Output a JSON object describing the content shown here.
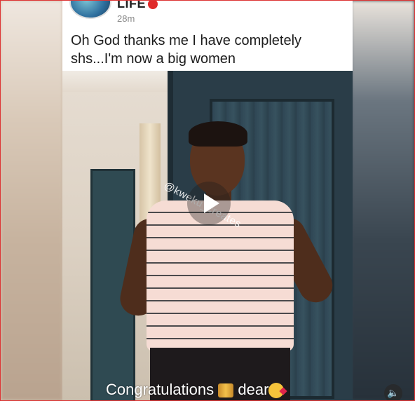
{
  "post": {
    "author_name": "LIFE",
    "timestamp": "28m",
    "caption": "Oh God thanks me I have completely shs...I'm now a big women"
  },
  "video": {
    "watermark": "@kweku_creates",
    "overlay_text": "Congratulations",
    "overlay_text_end": "dear",
    "play_icon": "play-icon",
    "volume_icon": "volume-icon"
  }
}
